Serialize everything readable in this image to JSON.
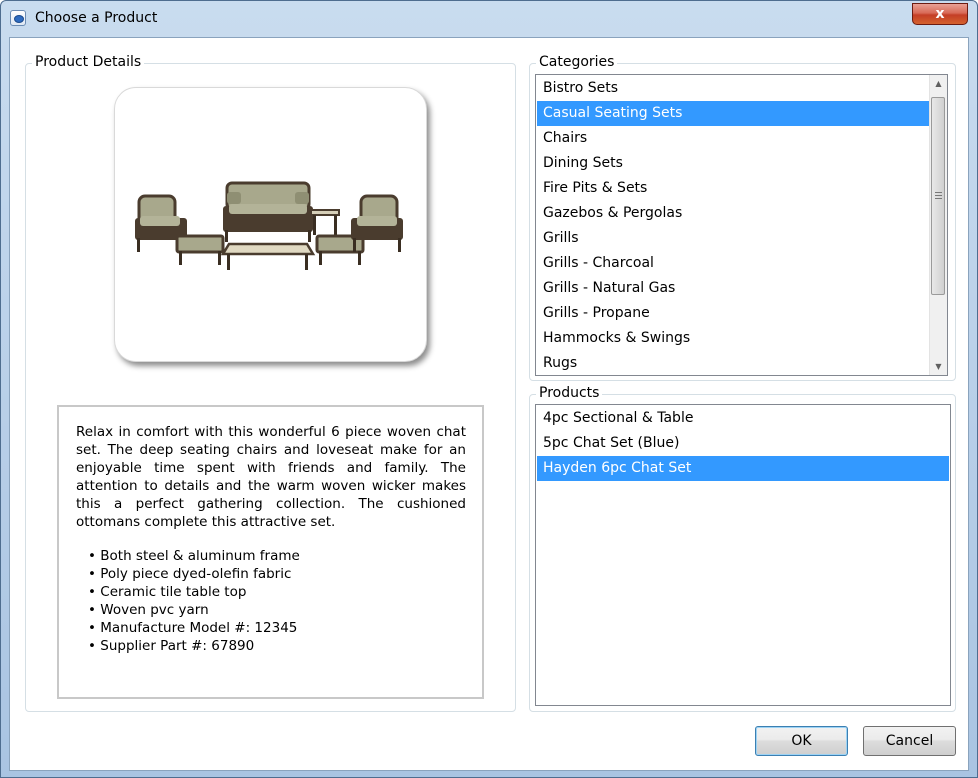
{
  "window": {
    "title": "Choose a Product",
    "close_label": "x"
  },
  "details": {
    "legend": "Product Details",
    "description": "Relax in comfort with this wonderful 6 piece woven chat set.  The deep seating chairs and loveseat make for an enjoyable time spent with friends and family.  The attention to details and the warm woven wicker makes this a perfect gathering collection.  The cushioned ottomans complete this attractive set.",
    "bullets": [
      "Both steel & aluminum frame",
      "Poly piece dyed-olefin fabric",
      "Ceramic tile table top",
      "Woven pvc yarn",
      "Manufacture Model #: 12345",
      "Supplier Part #: 67890"
    ]
  },
  "categories": {
    "legend": "Categories",
    "items": [
      "Bistro Sets",
      "Casual Seating Sets",
      "Chairs",
      "Dining Sets",
      "Fire Pits & Sets",
      "Gazebos & Pergolas",
      "Grills",
      "Grills - Charcoal",
      "Grills - Natural Gas",
      "Grills - Propane",
      "Hammocks & Swings",
      "Rugs"
    ],
    "selected_index": 1
  },
  "products": {
    "legend": "Products",
    "items": [
      "4pc Sectional & Table",
      "5pc Chat Set (Blue)",
      "Hayden 6pc Chat Set"
    ],
    "selected_index": 2
  },
  "buttons": {
    "ok_label": "OK",
    "cancel_label": "Cancel"
  },
  "colors": {
    "selection": "#3399ff",
    "cushion": "#a8a88c",
    "wicker": "#4a3c2e"
  }
}
